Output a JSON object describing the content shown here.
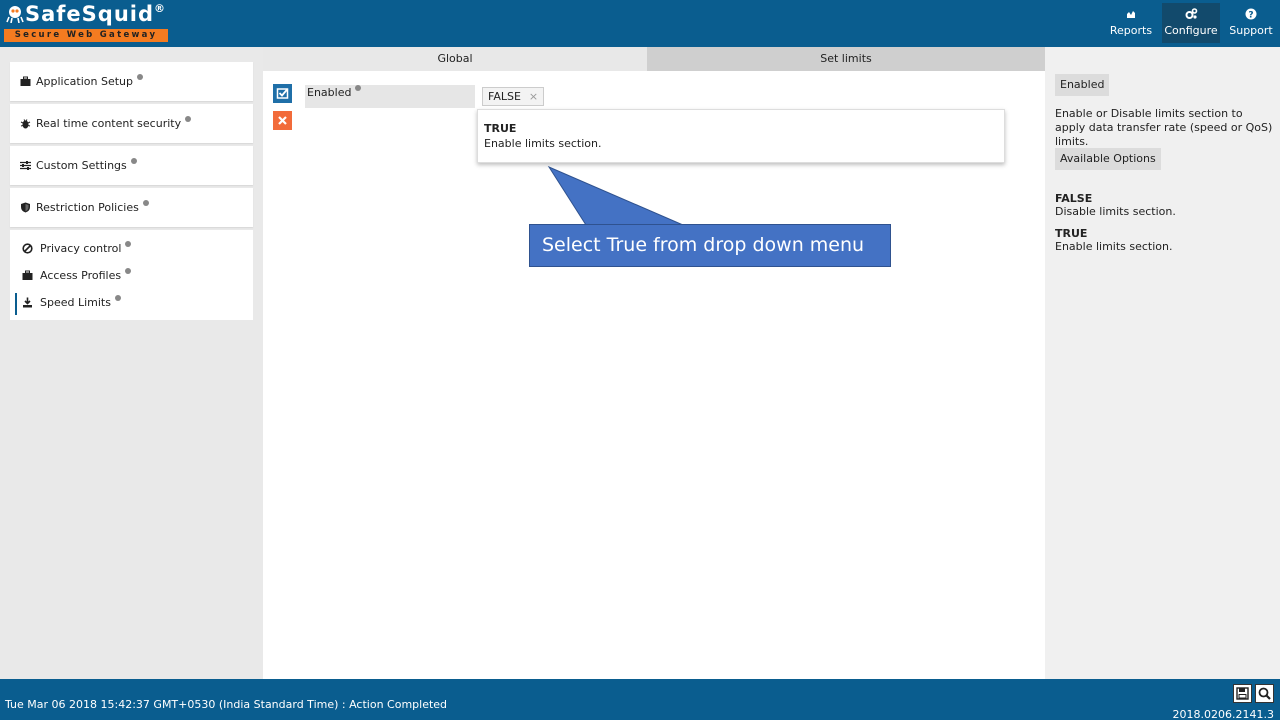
{
  "header": {
    "logo_text": "SafeSquid",
    "logo_reg": "®",
    "logo_tagline": "Secure Web Gateway",
    "nav": [
      {
        "label": "Reports",
        "icon": "chart-icon"
      },
      {
        "label": "Configure",
        "icon": "cogs-icon"
      },
      {
        "label": "Support",
        "icon": "question-icon"
      }
    ]
  },
  "sidebar": {
    "items": [
      {
        "label": "Application Setup",
        "icon": "briefcase-icon"
      },
      {
        "label": "Real time content security",
        "icon": "bug-icon"
      },
      {
        "label": "Custom Settings",
        "icon": "sliders-icon"
      },
      {
        "label": "Restriction Policies",
        "icon": "shield-icon"
      }
    ],
    "subitems": [
      {
        "label": "Privacy control",
        "icon": "ban-icon"
      },
      {
        "label": "Access Profiles",
        "icon": "briefcase-icon"
      },
      {
        "label": "Speed Limits",
        "icon": "download-icon"
      }
    ]
  },
  "main": {
    "tabs": [
      "Global",
      "Set limits"
    ],
    "field_label": "Enabled",
    "field_value": "FALSE",
    "chip_remove": "×",
    "dropdown": {
      "title": "TRUE",
      "description": "Enable limits section."
    },
    "callout": "Select True from drop down menu"
  },
  "right_panel": {
    "tag_enabled": "Enabled",
    "description": "Enable or Disable limits section to apply data transfer rate (speed or QoS) limits.",
    "tag_options": "Available Options",
    "options": [
      {
        "name": "FALSE",
        "desc": "Disable limits section."
      },
      {
        "name": "TRUE",
        "desc": "Enable limits section."
      }
    ]
  },
  "footer": {
    "status": "Tue Mar 06 2018 15:42:37 GMT+0530 (India Standard Time) : Action Completed",
    "version": "2018.0206.2141.3"
  },
  "colors": {
    "header_bg": "#0a5d8f",
    "accent_orange": "#f47b20",
    "callout_blue": "#4472c4"
  }
}
